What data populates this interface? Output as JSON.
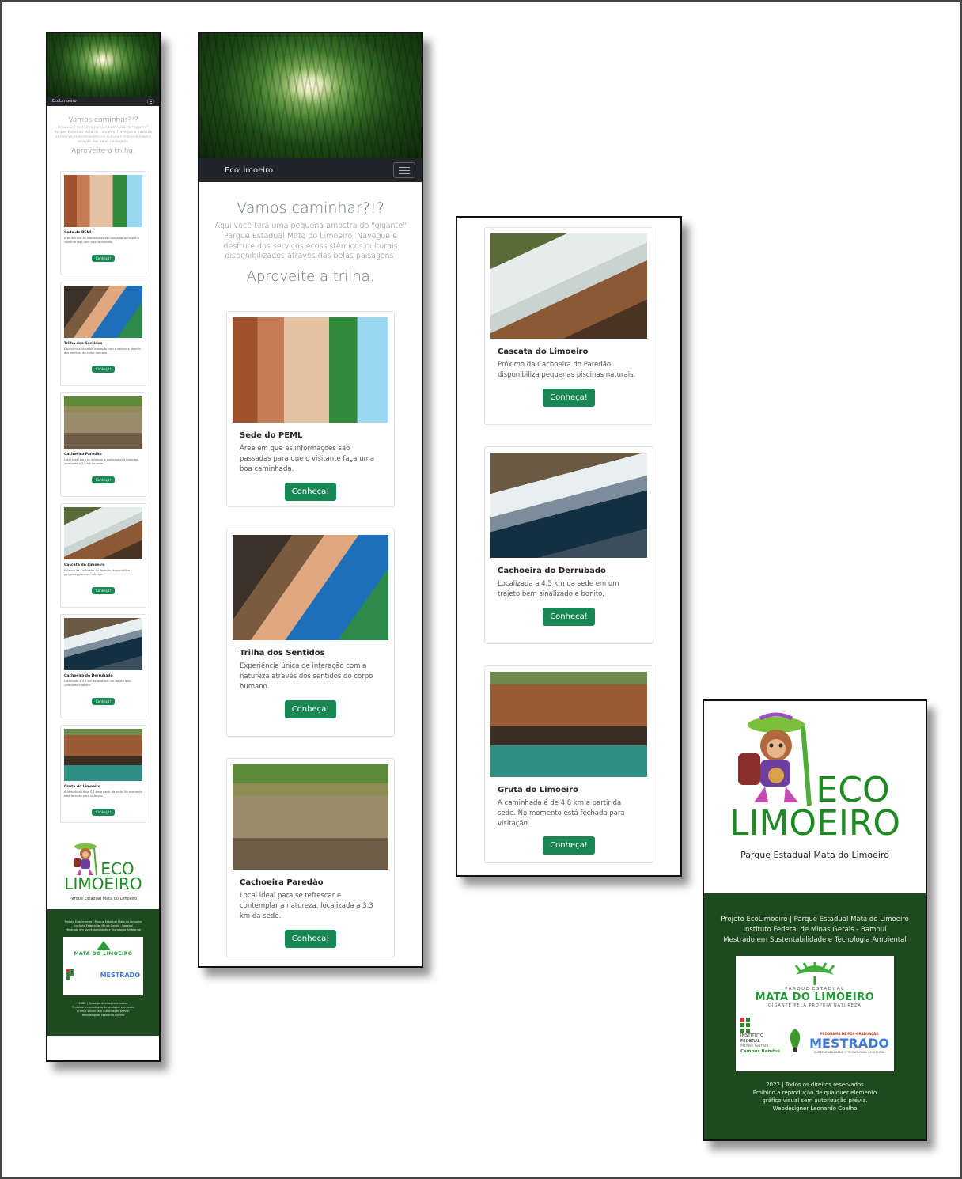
{
  "brand": "EcoLimoeiro",
  "hero": {
    "title": "Vamos caminhar?!?",
    "lead": "Aqui você terá uma pequena amostra do \"gigante\" Parque Estadual Mata do Limoeiro. Navegue e desfrute dos serviços ecossistêmicos culturais disponibilizados através das belas paisagens.",
    "subtitle": "Aproveite a trilha."
  },
  "button_label": "Conheça!",
  "cards": [
    {
      "title": "Sede do PEML",
      "text": "Área em que as informações são passadas para que o visitante faça uma boa caminhada.",
      "image": "sede"
    },
    {
      "title": "Trilha dos Sentidos",
      "text": "Experiência única de interação com a natureza através dos sentidos do corpo humano.",
      "image": "trilha"
    },
    {
      "title": "Cachoeira Paredão",
      "text": "Local ideal para se refrescar e contemplar a natureza, localizada a 3,3 km da sede.",
      "image": "paredao"
    },
    {
      "title": "Cascata do Limoeiro",
      "text": "Próximo da Cachoeira do Paredão, disponibiliza pequenas piscinas naturais.",
      "image": "cascata"
    },
    {
      "title": "Cachoeira do Derrubado",
      "text": "Localizada a 4,5 km da sede em um trajeto bem sinalizado e bonito.",
      "image": "derrubado"
    },
    {
      "title": "Gruta do Limoeiro",
      "text": "A caminhada é de 4,8 km a partir da sede. No momento está fechada para visitação.",
      "image": "gruta"
    }
  ],
  "logo": {
    "line1": "ECO",
    "line2": "LIMOEIRO",
    "caption": "Parque Estadual Mata do Limoeiro"
  },
  "footer": {
    "line1": "Projeto EcoLimoeiro | Parque Estadual Mata do Limoeiro",
    "line2": "Instituto Federal de Minas Gerais - Bambuí",
    "line3": "Mestrado em Sustentabilidade e Tecnologia Ambiental",
    "partner_top": "PARQUE ESTADUAL",
    "partner_name": "MATA DO LIMOEIRO",
    "partner_tagline": "GIGANTE PELA PRÓPRIA NATUREZA",
    "if_lines": [
      "INSTITUTO",
      "FEDERAL",
      "Minas Gerais",
      "Campus Bambuí"
    ],
    "mestrado_top": "PROGRAMA DE PÓS-GRADUAÇÃO",
    "mestrado": "MESTRADO",
    "mestrado_sub": "SUSTENTABILIDADE E TECNOLOGIA AMBIENTAL",
    "copyright": "2022 | Todos os direitos reservados",
    "notice1": "Proibido a reprodução de qualquer elemento",
    "notice2": "gráfico visual sem autorização prévia.",
    "credit": "Webdesigner Leonardo Coelho"
  },
  "colors": {
    "navbar": "#212529",
    "button": "#198754",
    "footer": "#1d4a1f",
    "logo_green": "#1e8a22"
  }
}
